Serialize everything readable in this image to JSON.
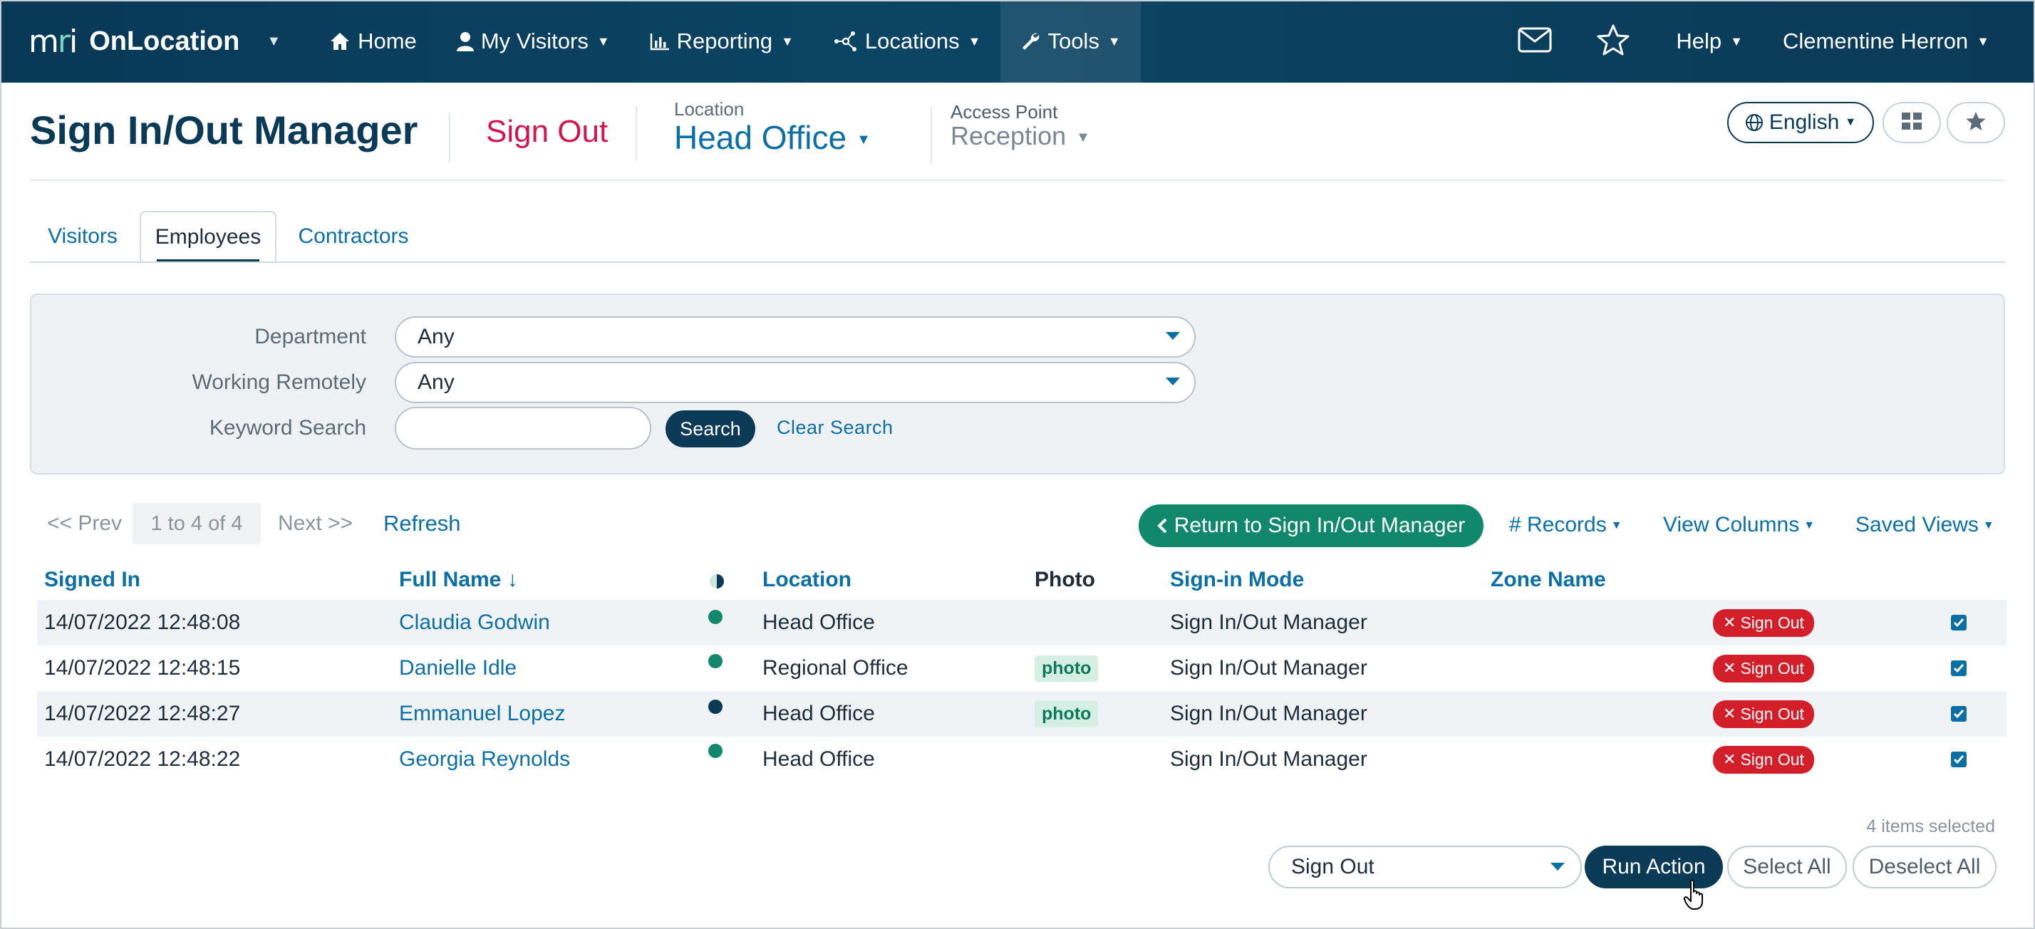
{
  "nav": {
    "logo_mri": "mri",
    "brand": "OnLocation",
    "items": [
      {
        "label": "Home",
        "icon": "home-icon"
      },
      {
        "label": "My Visitors",
        "icon": "user-icon"
      },
      {
        "label": "Reporting",
        "icon": "chart-icon"
      },
      {
        "label": "Locations",
        "icon": "network-icon"
      },
      {
        "label": "Tools",
        "icon": "wrench-icon"
      }
    ],
    "help": "Help",
    "user": "Clementine Herron"
  },
  "header": {
    "title": "Sign In/Out Manager",
    "mode": "Sign Out",
    "location_label": "Location",
    "location_value": "Head Office",
    "access_point_label": "Access Point",
    "access_point_value": "Reception",
    "language": "English"
  },
  "tabs": [
    "Visitors",
    "Employees",
    "Contractors"
  ],
  "active_tab": "Employees",
  "filters": {
    "department_label": "Department",
    "department_value": "Any",
    "remote_label": "Working Remotely",
    "remote_value": "Any",
    "keyword_label": "Keyword Search",
    "keyword_value": "",
    "search_button": "Search",
    "clear_link": "Clear Search"
  },
  "pager": {
    "prev": "<< Prev",
    "range": "1 to 4 of 4",
    "next": "Next >>",
    "refresh": "Refresh"
  },
  "toolbar": {
    "return_button": "Return to Sign In/Out Manager",
    "records": "# Records",
    "view_columns": "View Columns",
    "saved_views": "Saved Views"
  },
  "table": {
    "headers": {
      "signed_in": "Signed In",
      "full_name": "Full Name ↓",
      "location": "Location",
      "photo": "Photo",
      "sign_in_mode": "Sign-in Mode",
      "zone_name": "Zone Name"
    },
    "rows": [
      {
        "signed_in": "14/07/2022 12:48:08",
        "name": "Claudia Godwin",
        "status_color": "#13876b",
        "location": "Head Office",
        "photo": "",
        "mode": "Sign In/Out Manager",
        "zone": "",
        "action": "Sign Out",
        "checked": true
      },
      {
        "signed_in": "14/07/2022 12:48:15",
        "name": "Danielle Idle",
        "status_color": "#13876b",
        "location": "Regional Office",
        "photo": "photo",
        "mode": "Sign In/Out Manager",
        "zone": "",
        "action": "Sign Out",
        "checked": true
      },
      {
        "signed_in": "14/07/2022 12:48:27",
        "name": "Emmanuel Lopez",
        "status_color": "#0b3a57",
        "location": "Head Office",
        "photo": "photo",
        "mode": "Sign In/Out Manager",
        "zone": "",
        "action": "Sign Out",
        "checked": true
      },
      {
        "signed_in": "14/07/2022 12:48:22",
        "name": "Georgia Reynolds",
        "status_color": "#13876b",
        "location": "Head Office",
        "photo": "",
        "mode": "Sign In/Out Manager",
        "zone": "",
        "action": "Sign Out",
        "checked": true
      }
    ]
  },
  "footer": {
    "items_selected": "4 items selected",
    "action_value": "Sign Out",
    "run_button": "Run Action",
    "select_all": "Select All",
    "deselect_all": "Deselect All"
  },
  "colors": {
    "nav_bg": "#0a3d5c",
    "primary": "#0b3a57",
    "link": "#0b6fa4",
    "accent_red": "#d1164d",
    "green": "#11876c",
    "danger": "#d21f2a"
  }
}
